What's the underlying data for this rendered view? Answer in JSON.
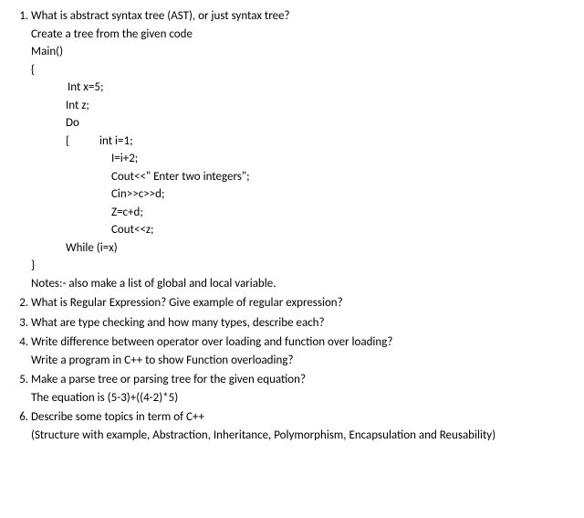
{
  "q1": {
    "text": "What is abstract syntax tree (AST), or just syntax tree?",
    "sub1": "Create a tree from the given code",
    "code": {
      "l1": "Main()",
      "l2": "{",
      "l3": "Int x=5;",
      "l4": "Int z;",
      "l5": "Do",
      "l6_open": "{",
      "l6_a": "int i=1;",
      "l7": "I=i+2;",
      "l8": "Cout<<\" Enter two integers\";",
      "l9": "Cin>>c>>d;",
      "l10": "Z=c+d;",
      "l11": "Cout<<z;",
      "l12": "While (i=x)",
      "l13": "}"
    },
    "notes": "Notes:- also make a list of global and local variable."
  },
  "q2": {
    "text": "What is Regular Expression? Give example of regular expression?"
  },
  "q3": {
    "text": "What are type checking and how many types, describe each?"
  },
  "q4": {
    "text": "Write difference between operator over loading and function over loading?",
    "sub1": "Write a program in C++ to show Function overloading?"
  },
  "q5": {
    "text": "Make a parse tree or parsing tree for the given equation?",
    "sub1": "The equation is (5-3)+((4-2)*5)"
  },
  "q6": {
    "text": "Describe some topics in term of C++",
    "sub1": "(Structure with example, Abstraction, Inheritance, Polymorphism, Encapsulation and Reusability)"
  }
}
